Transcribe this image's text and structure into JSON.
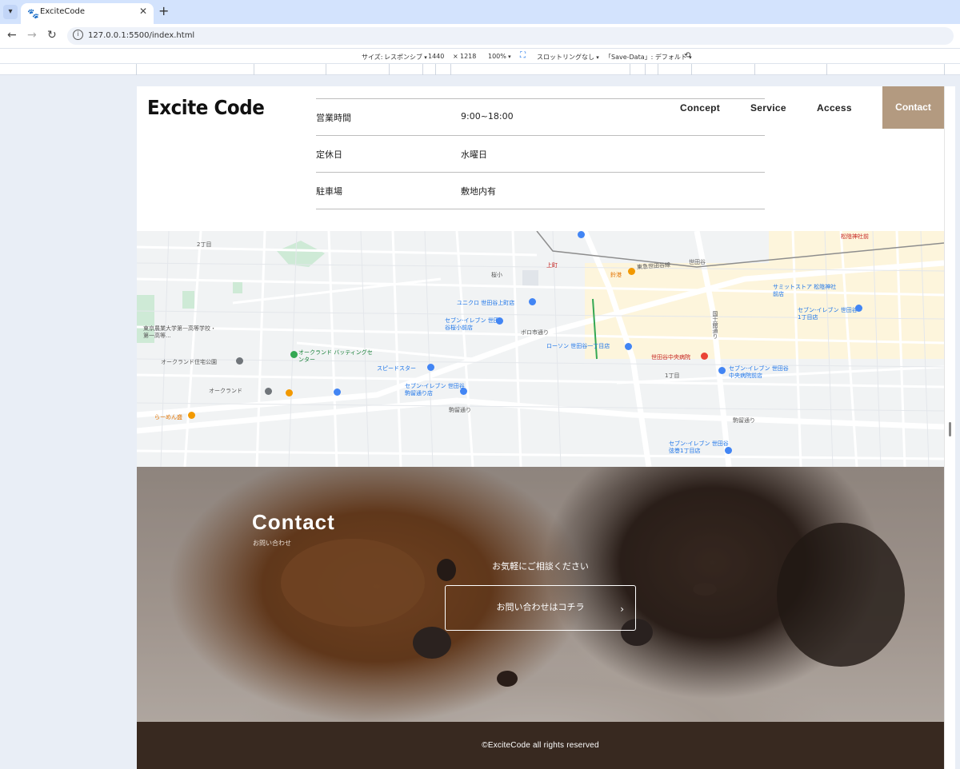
{
  "browser": {
    "tab_title": "ExciteCode",
    "url": "127.0.0.1:5500/index.html"
  },
  "devtools_bar": {
    "size_label": "サイズ:",
    "size_mode": "レスポンシブ",
    "width": "1440",
    "times": "×",
    "height": "1218",
    "zoom": "100%",
    "throttling": "スロットリングなし",
    "save_data": "「Save-Data」: デフォルト"
  },
  "header": {
    "logo": "Excite Code",
    "nav": {
      "concept": "Concept",
      "service": "Service",
      "access": "Access",
      "contact": "Contact"
    }
  },
  "info_table": [
    {
      "label": "営業時間",
      "value": "9:00~18:00"
    },
    {
      "label": "定休日",
      "value": "水曜日"
    },
    {
      "label": "駐車場",
      "value": "敷地内有"
    }
  ],
  "map": {
    "labels": [
      "2丁目",
      "松陰神社前",
      "上町",
      "世田谷",
      "東急世田谷線",
      "桜小",
      "鈴港",
      "サミットストア 松陰神社前店",
      "ユニクロ 世田谷上町店",
      "セブン-イレブン 世田谷桜小前店",
      "ボロ市通り",
      "セブン-イレブン 世田谷1丁目店",
      "東京農業大学第一高等学校・第一高等...",
      "ローソン 世田谷一丁目店",
      "オークランド バッティングセンター",
      "オークランド住宅公園",
      "スピードスター",
      "世田谷中央病院",
      "セブン-イレブン 世田谷中央病院前店",
      "オークランド",
      "セブン-イレブン 世田谷駒留通り店",
      "1丁目",
      "らーめん盛",
      "駒留通り",
      "セブン-イレブン 世田谷弦巻1丁目店",
      "国士舘通り"
    ]
  },
  "contact": {
    "title": "Contact",
    "subtitle": "お問い合わせ",
    "lead": "お気軽にご相談ください",
    "button": "お問い合わせはコチラ"
  },
  "footer": {
    "copyright": "©ExciteCode all rights reserved"
  }
}
